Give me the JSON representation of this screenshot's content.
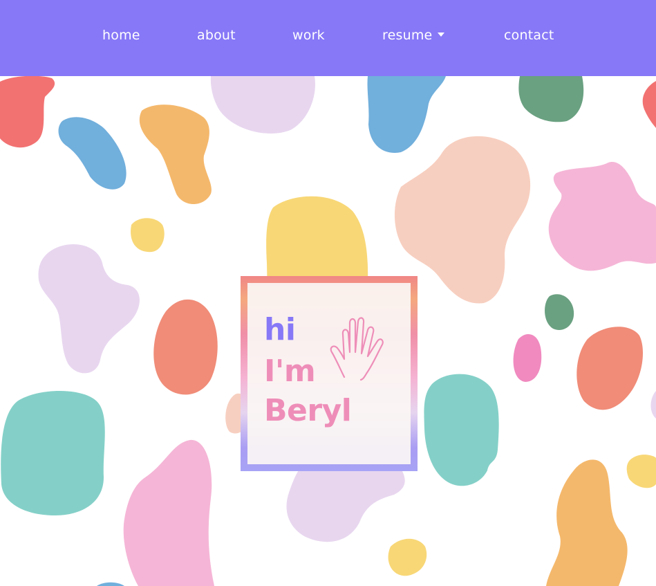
{
  "nav": {
    "items": [
      {
        "label": "home"
      },
      {
        "label": "about"
      },
      {
        "label": "work"
      },
      {
        "label": "resume",
        "has_dropdown": true
      },
      {
        "label": "contact"
      }
    ]
  },
  "hero": {
    "greeting_line1": "hi",
    "greeting_line2": "I'm",
    "greeting_name": "Beryl",
    "hand_icon": "waving-hand-icon"
  },
  "colors": {
    "nav_background": "#8778f7",
    "accent_purple": "#8778f7",
    "accent_pink": "#ee8eb8",
    "blob_red": "#f27272",
    "blob_lavender": "#e8d6ef",
    "blob_blue": "#71afdc",
    "blob_green": "#6aa181",
    "blob_orange": "#f4b86c",
    "blob_peach": "#f7cfc0",
    "blob_yellow": "#f8d776",
    "blob_pink": "#f5b5d6",
    "blob_coral": "#f08c78",
    "blob_teal": "#84d0c8",
    "blob_magenta": "#f08abf"
  }
}
